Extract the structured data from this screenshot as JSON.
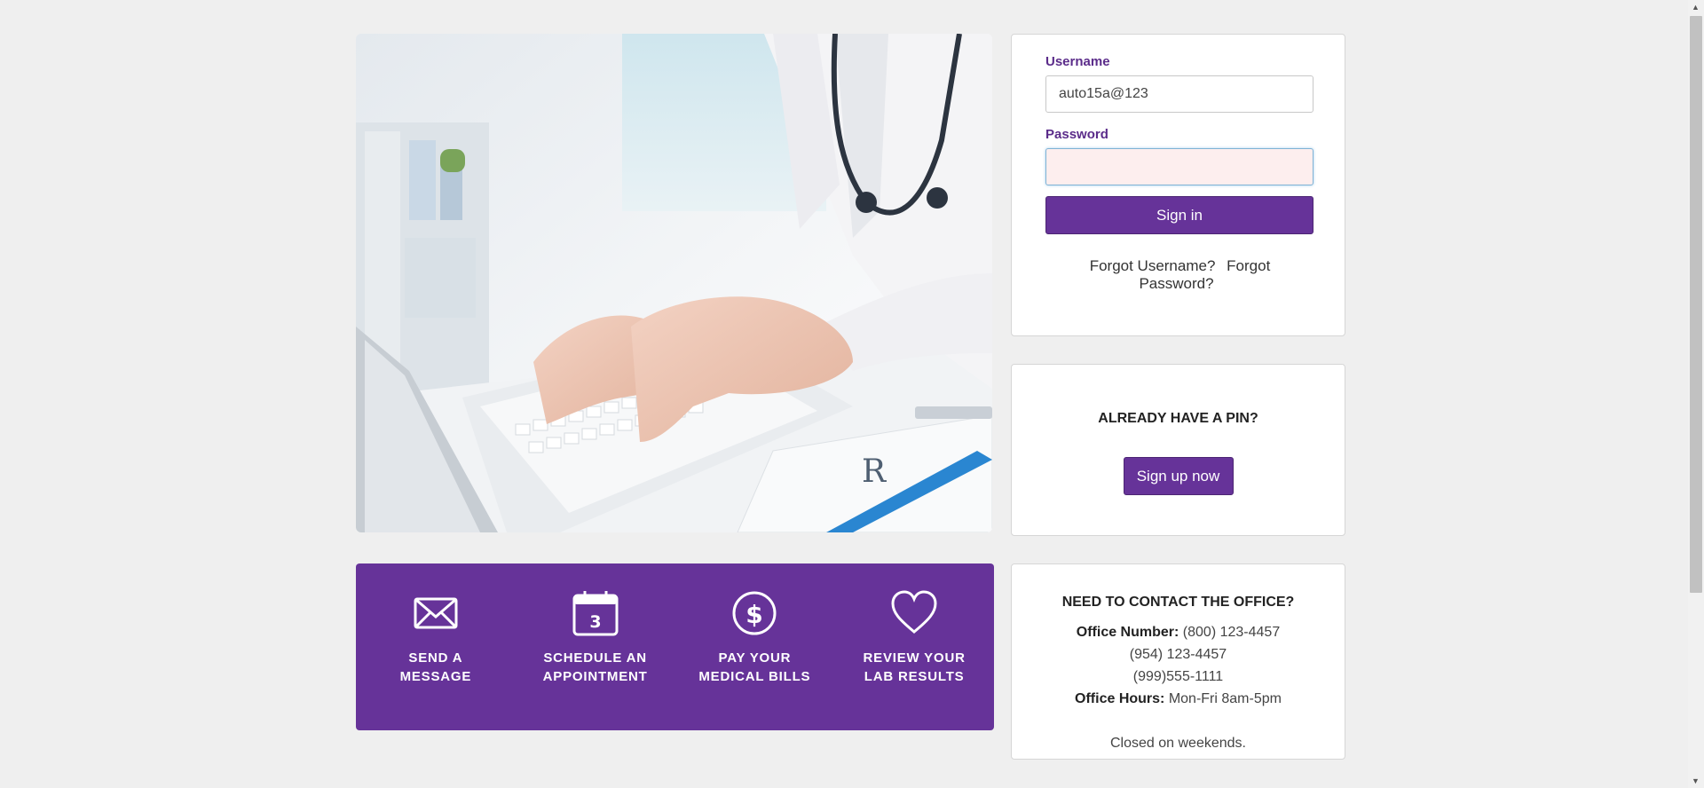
{
  "login": {
    "username_label": "Username",
    "username_value": "auto15a@123",
    "password_label": "Password",
    "password_value": "",
    "signin_label": "Sign in",
    "forgot_username": "Forgot Username?",
    "forgot_password": "Forgot Password?"
  },
  "pin": {
    "heading": "ALREADY HAVE A PIN?",
    "signup_label": "Sign up now"
  },
  "features": [
    {
      "label": "SEND A\nMESSAGE",
      "icon": "envelope-icon"
    },
    {
      "label": "SCHEDULE AN\nAPPOINTMENT",
      "icon": "calendar-icon",
      "calendar_day": "3"
    },
    {
      "label": "PAY YOUR\nMEDICAL BILLS",
      "icon": "dollar-icon"
    },
    {
      "label": "REVIEW YOUR\nLAB RESULTS",
      "icon": "heart-icon"
    }
  ],
  "contact": {
    "heading": "NEED TO CONTACT THE OFFICE?",
    "office_number_label": "Office Number:",
    "office_number_1": "(800) 123-4457",
    "office_number_2": "(954) 123-4457",
    "office_number_3": "(999)555-1111",
    "office_hours_label": "Office Hours:",
    "office_hours": "Mon-Fri 8am-5pm",
    "closed_note": "Closed on weekends."
  },
  "colors": {
    "brand_purple": "#663399",
    "label_purple": "#5b2c8a",
    "page_background": "#efefef"
  }
}
